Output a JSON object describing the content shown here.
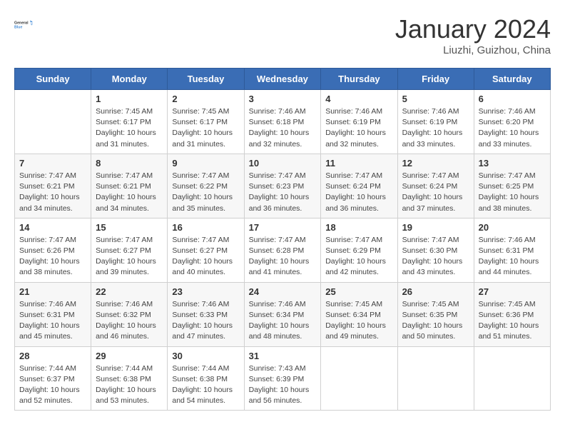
{
  "header": {
    "logo_line1": "General",
    "logo_line2": "Blue",
    "title": "January 2024",
    "subtitle": "Liuzhi, Guizhou, China"
  },
  "days_of_week": [
    "Sunday",
    "Monday",
    "Tuesday",
    "Wednesday",
    "Thursday",
    "Friday",
    "Saturday"
  ],
  "weeks": [
    [
      {
        "num": "",
        "info": ""
      },
      {
        "num": "1",
        "info": "Sunrise: 7:45 AM\nSunset: 6:17 PM\nDaylight: 10 hours\nand 31 minutes."
      },
      {
        "num": "2",
        "info": "Sunrise: 7:45 AM\nSunset: 6:17 PM\nDaylight: 10 hours\nand 31 minutes."
      },
      {
        "num": "3",
        "info": "Sunrise: 7:46 AM\nSunset: 6:18 PM\nDaylight: 10 hours\nand 32 minutes."
      },
      {
        "num": "4",
        "info": "Sunrise: 7:46 AM\nSunset: 6:19 PM\nDaylight: 10 hours\nand 32 minutes."
      },
      {
        "num": "5",
        "info": "Sunrise: 7:46 AM\nSunset: 6:19 PM\nDaylight: 10 hours\nand 33 minutes."
      },
      {
        "num": "6",
        "info": "Sunrise: 7:46 AM\nSunset: 6:20 PM\nDaylight: 10 hours\nand 33 minutes."
      }
    ],
    [
      {
        "num": "7",
        "info": "Sunrise: 7:47 AM\nSunset: 6:21 PM\nDaylight: 10 hours\nand 34 minutes."
      },
      {
        "num": "8",
        "info": "Sunrise: 7:47 AM\nSunset: 6:21 PM\nDaylight: 10 hours\nand 34 minutes."
      },
      {
        "num": "9",
        "info": "Sunrise: 7:47 AM\nSunset: 6:22 PM\nDaylight: 10 hours\nand 35 minutes."
      },
      {
        "num": "10",
        "info": "Sunrise: 7:47 AM\nSunset: 6:23 PM\nDaylight: 10 hours\nand 36 minutes."
      },
      {
        "num": "11",
        "info": "Sunrise: 7:47 AM\nSunset: 6:24 PM\nDaylight: 10 hours\nand 36 minutes."
      },
      {
        "num": "12",
        "info": "Sunrise: 7:47 AM\nSunset: 6:24 PM\nDaylight: 10 hours\nand 37 minutes."
      },
      {
        "num": "13",
        "info": "Sunrise: 7:47 AM\nSunset: 6:25 PM\nDaylight: 10 hours\nand 38 minutes."
      }
    ],
    [
      {
        "num": "14",
        "info": "Sunrise: 7:47 AM\nSunset: 6:26 PM\nDaylight: 10 hours\nand 38 minutes."
      },
      {
        "num": "15",
        "info": "Sunrise: 7:47 AM\nSunset: 6:27 PM\nDaylight: 10 hours\nand 39 minutes."
      },
      {
        "num": "16",
        "info": "Sunrise: 7:47 AM\nSunset: 6:27 PM\nDaylight: 10 hours\nand 40 minutes."
      },
      {
        "num": "17",
        "info": "Sunrise: 7:47 AM\nSunset: 6:28 PM\nDaylight: 10 hours\nand 41 minutes."
      },
      {
        "num": "18",
        "info": "Sunrise: 7:47 AM\nSunset: 6:29 PM\nDaylight: 10 hours\nand 42 minutes."
      },
      {
        "num": "19",
        "info": "Sunrise: 7:47 AM\nSunset: 6:30 PM\nDaylight: 10 hours\nand 43 minutes."
      },
      {
        "num": "20",
        "info": "Sunrise: 7:46 AM\nSunset: 6:31 PM\nDaylight: 10 hours\nand 44 minutes."
      }
    ],
    [
      {
        "num": "21",
        "info": "Sunrise: 7:46 AM\nSunset: 6:31 PM\nDaylight: 10 hours\nand 45 minutes."
      },
      {
        "num": "22",
        "info": "Sunrise: 7:46 AM\nSunset: 6:32 PM\nDaylight: 10 hours\nand 46 minutes."
      },
      {
        "num": "23",
        "info": "Sunrise: 7:46 AM\nSunset: 6:33 PM\nDaylight: 10 hours\nand 47 minutes."
      },
      {
        "num": "24",
        "info": "Sunrise: 7:46 AM\nSunset: 6:34 PM\nDaylight: 10 hours\nand 48 minutes."
      },
      {
        "num": "25",
        "info": "Sunrise: 7:45 AM\nSunset: 6:34 PM\nDaylight: 10 hours\nand 49 minutes."
      },
      {
        "num": "26",
        "info": "Sunrise: 7:45 AM\nSunset: 6:35 PM\nDaylight: 10 hours\nand 50 minutes."
      },
      {
        "num": "27",
        "info": "Sunrise: 7:45 AM\nSunset: 6:36 PM\nDaylight: 10 hours\nand 51 minutes."
      }
    ],
    [
      {
        "num": "28",
        "info": "Sunrise: 7:44 AM\nSunset: 6:37 PM\nDaylight: 10 hours\nand 52 minutes."
      },
      {
        "num": "29",
        "info": "Sunrise: 7:44 AM\nSunset: 6:38 PM\nDaylight: 10 hours\nand 53 minutes."
      },
      {
        "num": "30",
        "info": "Sunrise: 7:44 AM\nSunset: 6:38 PM\nDaylight: 10 hours\nand 54 minutes."
      },
      {
        "num": "31",
        "info": "Sunrise: 7:43 AM\nSunset: 6:39 PM\nDaylight: 10 hours\nand 56 minutes."
      },
      {
        "num": "",
        "info": ""
      },
      {
        "num": "",
        "info": ""
      },
      {
        "num": "",
        "info": ""
      }
    ]
  ]
}
